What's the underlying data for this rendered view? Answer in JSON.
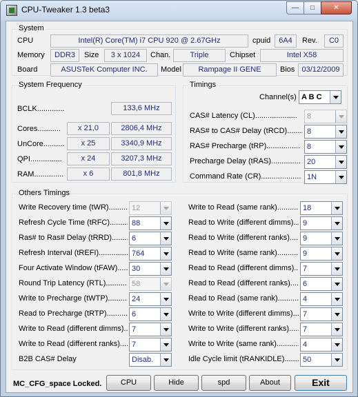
{
  "window": {
    "title": "CPU-Tweaker 1.3 beta3"
  },
  "system": {
    "label": "System",
    "cpu_label": "CPU",
    "cpu_value": "Intel(R) Core(TM) i7 CPU       920  @ 2.67GHz",
    "cpuid_label": "cpuid",
    "cpuid_value": "6A4",
    "rev_label": "Rev.",
    "rev_value": "C0",
    "memory_label": "Memory",
    "memory_value": "DDR3",
    "size_label": "Size",
    "size_value": "3 x 1024",
    "chan_label": "Chan.",
    "chan_value": "Triple",
    "chipset_label": "Chipset",
    "chipset_value": "Intel X58",
    "board_label": "Board",
    "board_value": "ASUSTeK Computer INC.",
    "model_label": "Model",
    "model_value": "Rampage II GENE",
    "bios_label": "Bios",
    "bios_value": "03/12/2009"
  },
  "freq": {
    "label": "System Frequency",
    "bclk_label": "BCLK.............",
    "bclk_value": "133,6 MHz",
    "cores_label": "Cores...........",
    "cores_mult": "x 21,0",
    "cores_value": "2806,4 MHz",
    "uncore_label": "UnCore..........",
    "uncore_mult": "x 25",
    "uncore_value": "3340,9 MHz",
    "qpi_label": "QPI...............",
    "qpi_mult": "x 24",
    "qpi_value": "3207,3 MHz",
    "ram_label": "RAM..............",
    "ram_mult": "x 6",
    "ram_value": "801,8 MHz"
  },
  "timings": {
    "label": "Timings",
    "channels_label": "Channel(s)",
    "channels_value": "A B C",
    "rows": [
      {
        "label": "CAS# Latency (CL)....................",
        "value": "8",
        "disabled": true
      },
      {
        "label": "RAS# to CAS# Delay (tRCD)........",
        "value": "8",
        "disabled": false
      },
      {
        "label": "RAS# Precharge (tRP)................",
        "value": "8",
        "disabled": false
      },
      {
        "label": "Precharge Delay (tRAS)..............",
        "value": "20",
        "disabled": false
      },
      {
        "label": "Command Rate (CR)...................",
        "value": "1N",
        "disabled": false
      }
    ]
  },
  "other": {
    "label": "Others Timings",
    "left": [
      {
        "label": "Write Recovery time (tWR).............",
        "value": "12",
        "disabled": true
      },
      {
        "label": "Refresh Cycle Time (tRFC)...........",
        "value": "88",
        "disabled": false
      },
      {
        "label": "Ras# to Ras# Delay (tRRD)...........",
        "value": "6",
        "disabled": false
      },
      {
        "label": "Refresh Interval (tREFI)...............",
        "value": "764",
        "disabled": false
      },
      {
        "label": "Four Activate Window (tFAW)........",
        "value": "30",
        "disabled": false
      },
      {
        "label": "Round Trip Latency (RTL)............",
        "value": "58",
        "disabled": true
      },
      {
        "label": "Write to Precharge (tWTP)...........",
        "value": "24",
        "disabled": false
      },
      {
        "label": "Read to Precharge (tRTP)............",
        "value": "6",
        "disabled": false
      },
      {
        "label": "Write to Read (different dimms)......",
        "value": "7",
        "disabled": false
      },
      {
        "label": "Write to Read (different ranks)......",
        "value": "7",
        "disabled": false
      },
      {
        "label": "B2B CAS# Delay",
        "value": "Disab.",
        "disabled": false
      }
    ],
    "right": [
      {
        "label": "Write to Read (same rank)..............",
        "value": "18"
      },
      {
        "label": "Read to Write (different dimms)......",
        "value": "9"
      },
      {
        "label": "Read to Write (different ranks)......",
        "value": "9"
      },
      {
        "label": "Read to Write (same rank)..............",
        "value": "9"
      },
      {
        "label": "Read to Read (different dimms)......",
        "value": "7"
      },
      {
        "label": "Read to Read (different ranks)......",
        "value": "6"
      },
      {
        "label": "Read to Read (same rank)..............",
        "value": "4"
      },
      {
        "label": "Write to Write (different dimms)......",
        "value": "7"
      },
      {
        "label": "Write to Write (different ranks)......",
        "value": "7"
      },
      {
        "label": "Write to Write (same rank)..............",
        "value": "4"
      },
      {
        "label": "Idle Cycle limit (tRANKIDLE)..........",
        "value": "50"
      }
    ]
  },
  "footer": {
    "status": "MC_CFG_space Locked.",
    "cpu_button": "CPU",
    "hide_button": "Hide",
    "spd_button": "spd",
    "about_button": "About",
    "exit_button": "Exit"
  }
}
